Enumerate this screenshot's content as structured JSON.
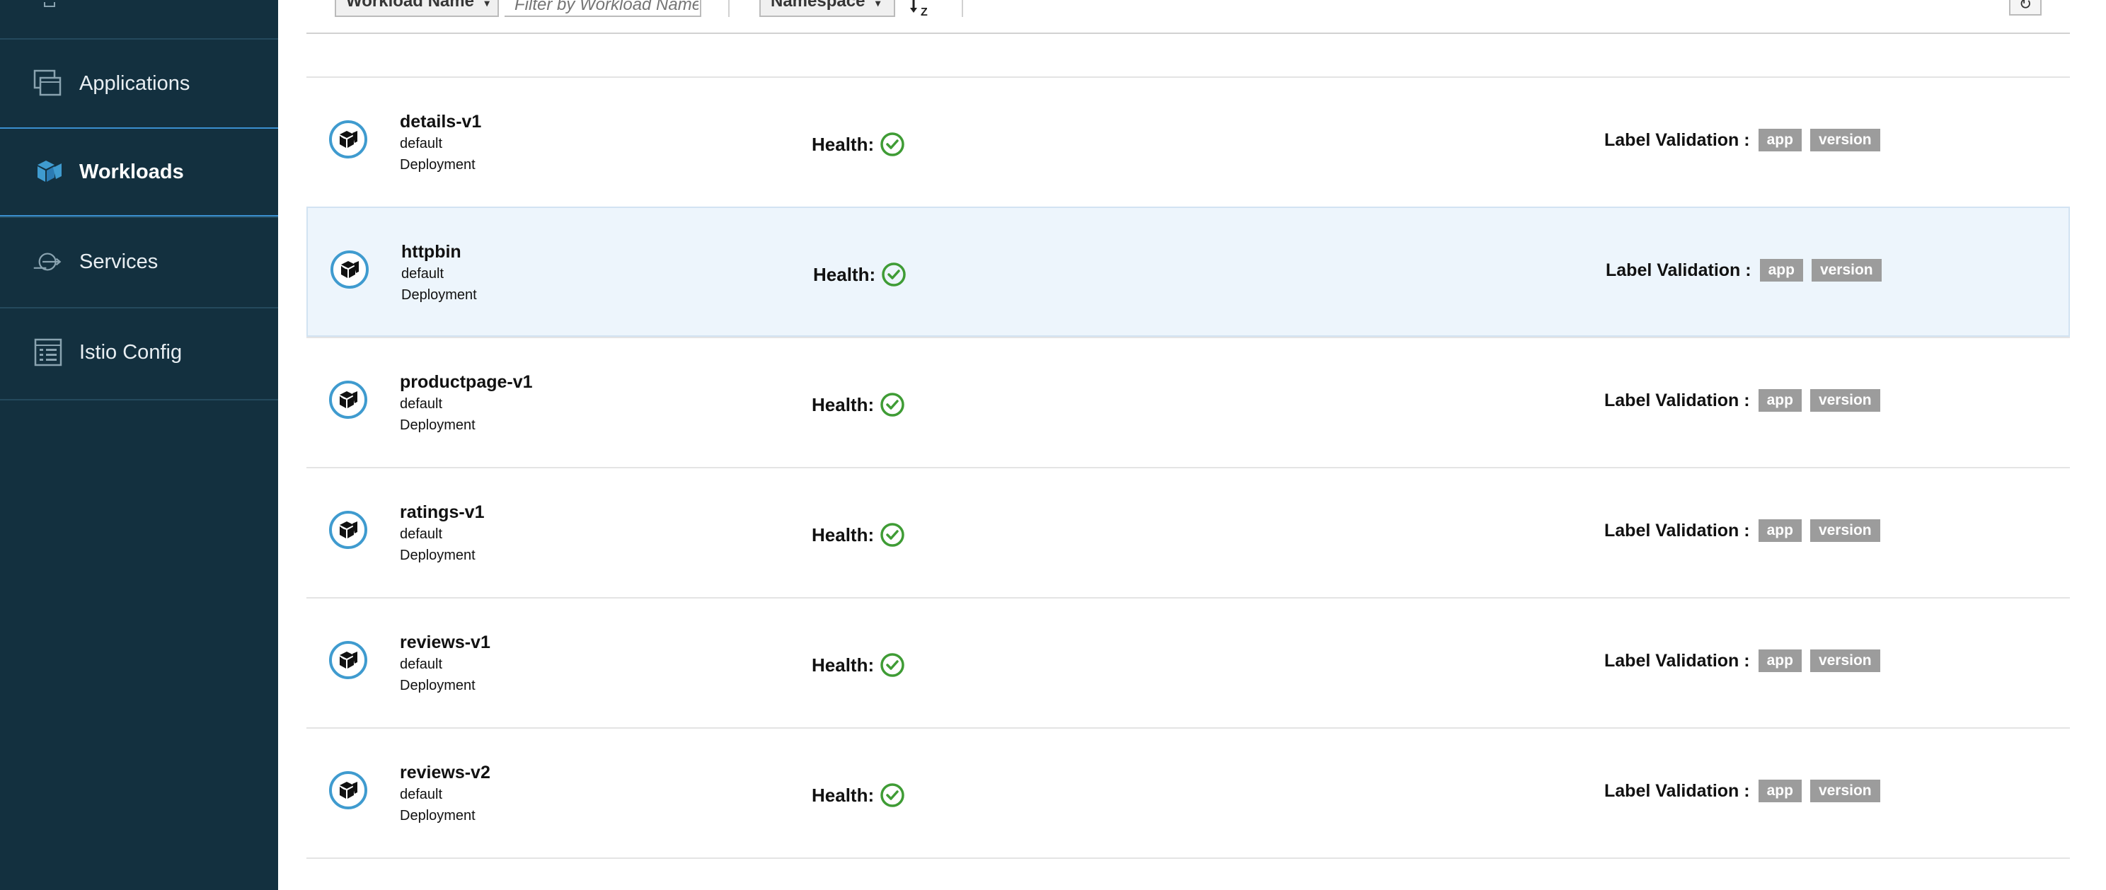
{
  "sidebar": {
    "items": [
      {
        "label": "Applications",
        "icon": "applications-icon",
        "active": false
      },
      {
        "label": "Workloads",
        "icon": "workloads-icon",
        "active": true
      },
      {
        "label": "Services",
        "icon": "services-icon",
        "active": false
      },
      {
        "label": "Istio Config",
        "icon": "istio-config-icon",
        "active": false
      }
    ]
  },
  "toolbar": {
    "filter_type": "Workload Name",
    "filter_placeholder": "Filter by Workload Name",
    "sort_field": "Namespace",
    "sort_direction_icon": "sort-alpha-asc-icon",
    "refresh_icon": "refresh-icon"
  },
  "colors": {
    "sidebar_bg": "#13303f",
    "accent": "#3f9bcf",
    "health_ok": "#3f9c35",
    "badge_bg": "#9c9c9c",
    "row_highlight": "#edf5fc"
  },
  "workloads": [
    {
      "name": "details-v1",
      "namespace": "default",
      "type": "Deployment",
      "health_label": "Health:",
      "health": "healthy",
      "label_validation": "Label Validation :",
      "labels": [
        "app",
        "version"
      ]
    },
    {
      "name": "httpbin",
      "namespace": "default",
      "type": "Deployment",
      "health_label": "Health:",
      "health": "healthy",
      "label_validation": "Label Validation :",
      "labels": [
        "app",
        "version"
      ]
    },
    {
      "name": "productpage-v1",
      "namespace": "default",
      "type": "Deployment",
      "health_label": "Health:",
      "health": "healthy",
      "label_validation": "Label Validation :",
      "labels": [
        "app",
        "version"
      ]
    },
    {
      "name": "ratings-v1",
      "namespace": "default",
      "type": "Deployment",
      "health_label": "Health:",
      "health": "healthy",
      "label_validation": "Label Validation :",
      "labels": [
        "app",
        "version"
      ]
    },
    {
      "name": "reviews-v1",
      "namespace": "default",
      "type": "Deployment",
      "health_label": "Health:",
      "health": "healthy",
      "label_validation": "Label Validation :",
      "labels": [
        "app",
        "version"
      ]
    },
    {
      "name": "reviews-v2",
      "namespace": "default",
      "type": "Deployment",
      "health_label": "Health:",
      "health": "healthy",
      "label_validation": "Label Validation :",
      "labels": [
        "app",
        "version"
      ]
    }
  ]
}
